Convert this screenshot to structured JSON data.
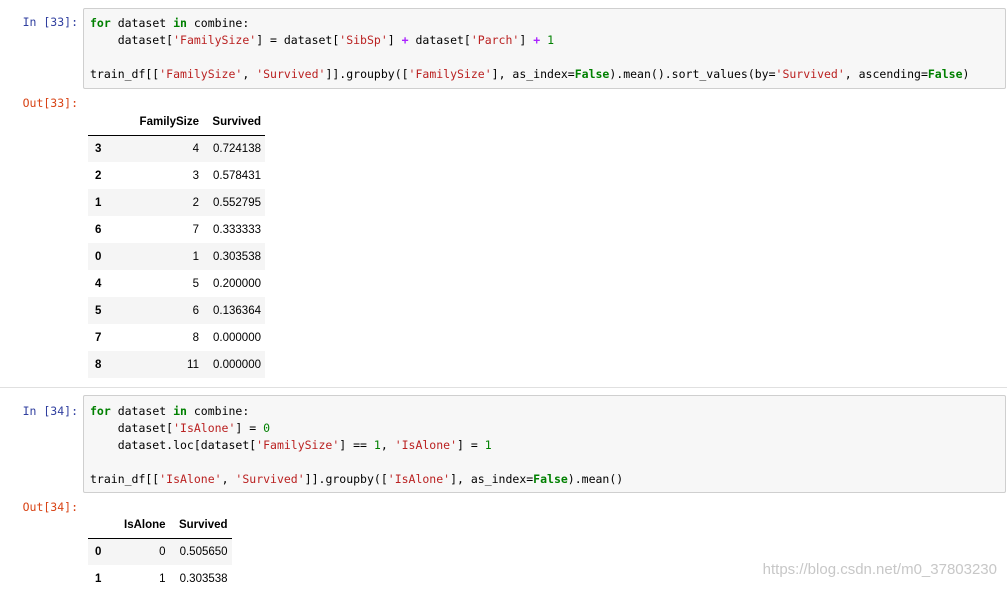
{
  "cells": [
    {
      "in_prompt": "In  [33]:",
      "out_prompt": "Out[33]:",
      "code_lines": [
        [
          {
            "t": "for",
            "c": "kw"
          },
          {
            "t": " dataset ",
            "c": ""
          },
          {
            "t": "in",
            "c": "kw"
          },
          {
            "t": " combine:",
            "c": ""
          }
        ],
        [
          {
            "t": "    dataset[",
            "c": ""
          },
          {
            "t": "'FamilySize'",
            "c": "str"
          },
          {
            "t": "] = dataset[",
            "c": ""
          },
          {
            "t": "'SibSp'",
            "c": "str"
          },
          {
            "t": "] ",
            "c": ""
          },
          {
            "t": "+",
            "c": "op"
          },
          {
            "t": " dataset[",
            "c": ""
          },
          {
            "t": "'Parch'",
            "c": "str"
          },
          {
            "t": "] ",
            "c": ""
          },
          {
            "t": "+",
            "c": "op"
          },
          {
            "t": " ",
            "c": ""
          },
          {
            "t": "1",
            "c": "num"
          }
        ],
        [],
        [
          {
            "t": "train_df[[",
            "c": ""
          },
          {
            "t": "'FamilySize'",
            "c": "str"
          },
          {
            "t": ", ",
            "c": ""
          },
          {
            "t": "'Survived'",
            "c": "str"
          },
          {
            "t": "]].groupby([",
            "c": ""
          },
          {
            "t": "'FamilySize'",
            "c": "str"
          },
          {
            "t": "], as_index=",
            "c": ""
          },
          {
            "t": "False",
            "c": "kw"
          },
          {
            "t": ").mean().sort_values(by=",
            "c": ""
          },
          {
            "t": "'Survived'",
            "c": "str"
          },
          {
            "t": ", ascending=",
            "c": ""
          },
          {
            "t": "False",
            "c": "kw"
          },
          {
            "t": ")",
            "c": ""
          }
        ]
      ],
      "table": {
        "columns": [
          "",
          "FamilySize",
          "Survived"
        ],
        "rows": [
          [
            "3",
            "4",
            "0.724138"
          ],
          [
            "2",
            "3",
            "0.578431"
          ],
          [
            "1",
            "2",
            "0.552795"
          ],
          [
            "6",
            "7",
            "0.333333"
          ],
          [
            "0",
            "1",
            "0.303538"
          ],
          [
            "4",
            "5",
            "0.200000"
          ],
          [
            "5",
            "6",
            "0.136364"
          ],
          [
            "7",
            "8",
            "0.000000"
          ],
          [
            "8",
            "11",
            "0.000000"
          ]
        ]
      }
    },
    {
      "in_prompt": "In  [34]:",
      "out_prompt": "Out[34]:",
      "code_lines": [
        [
          {
            "t": "for",
            "c": "kw"
          },
          {
            "t": " dataset ",
            "c": ""
          },
          {
            "t": "in",
            "c": "kw"
          },
          {
            "t": " combine:",
            "c": ""
          }
        ],
        [
          {
            "t": "    dataset[",
            "c": ""
          },
          {
            "t": "'IsAlone'",
            "c": "str"
          },
          {
            "t": "] = ",
            "c": ""
          },
          {
            "t": "0",
            "c": "num"
          }
        ],
        [
          {
            "t": "    dataset.loc[dataset[",
            "c": ""
          },
          {
            "t": "'FamilySize'",
            "c": "str"
          },
          {
            "t": "] == ",
            "c": ""
          },
          {
            "t": "1",
            "c": "num"
          },
          {
            "t": ", ",
            "c": ""
          },
          {
            "t": "'IsAlone'",
            "c": "str"
          },
          {
            "t": "] = ",
            "c": ""
          },
          {
            "t": "1",
            "c": "num"
          }
        ],
        [],
        [
          {
            "t": "train_df[[",
            "c": ""
          },
          {
            "t": "'IsAlone'",
            "c": "str"
          },
          {
            "t": ", ",
            "c": ""
          },
          {
            "t": "'Survived'",
            "c": "str"
          },
          {
            "t": "]].groupby([",
            "c": ""
          },
          {
            "t": "'IsAlone'",
            "c": "str"
          },
          {
            "t": "], as_index=",
            "c": ""
          },
          {
            "t": "False",
            "c": "kw"
          },
          {
            "t": ").mean()",
            "c": ""
          }
        ]
      ],
      "table": {
        "columns": [
          "",
          "IsAlone",
          "Survived"
        ],
        "rows": [
          [
            "0",
            "0",
            "0.505650"
          ],
          [
            "1",
            "1",
            "0.303538"
          ]
        ]
      }
    }
  ],
  "watermark": "https://blog.csdn.net/m0_37803230",
  "colors": {
    "keyword": "#008000",
    "string": "#ba2121",
    "operator": "#aa22ff",
    "in_prompt": "#303f9f",
    "out_prompt": "#d84315",
    "code_bg": "#f7f7f7"
  }
}
